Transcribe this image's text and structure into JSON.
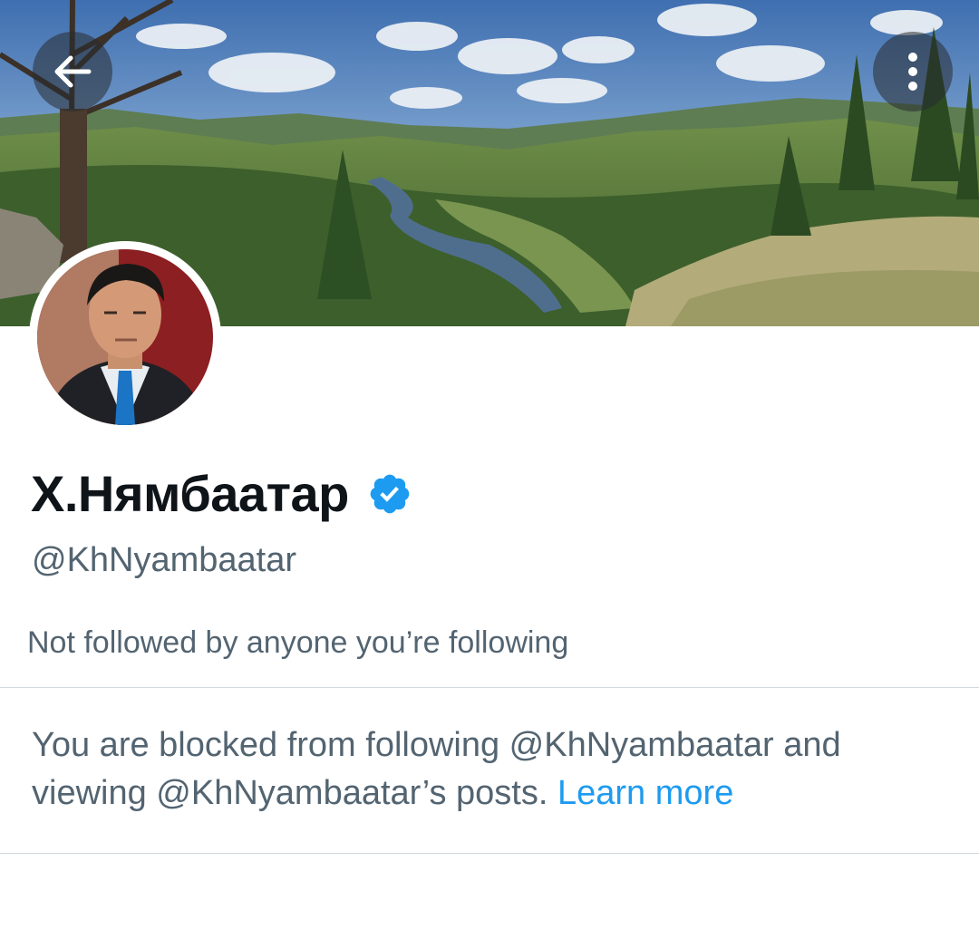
{
  "header": {
    "back_icon": "arrow-left-icon",
    "more_icon": "more-vertical-icon"
  },
  "profile": {
    "display_name": "Х.Нямбаатар",
    "verified": true,
    "verified_color": "#1d9bf0",
    "handle": "@KhNyambaatar",
    "followed_by": "Not followed by anyone you’re following"
  },
  "blocked_notice": {
    "line": "You are blocked from following @KhNyambaatar and viewing @KhNyambaatar’s posts.",
    "learn_more_label": "Learn more",
    "link_color": "#1d9bf0"
  }
}
